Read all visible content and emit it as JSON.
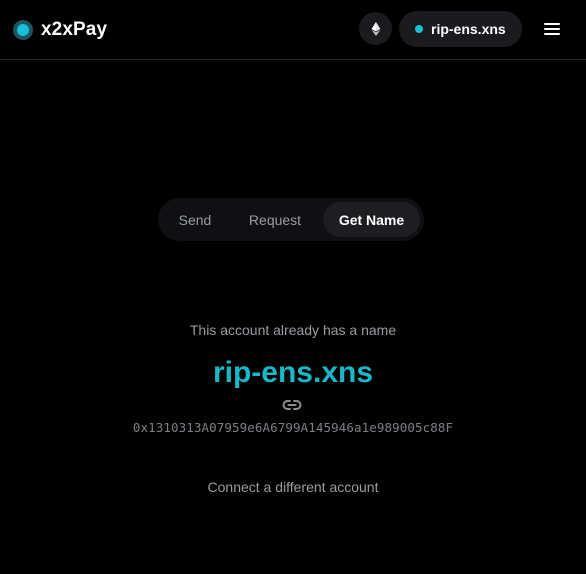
{
  "header": {
    "brand_name": "x2xPay",
    "network_icon": "ethereum-icon",
    "account_name": "rip-ens.xns",
    "menu_icon": "hamburger-menu-icon"
  },
  "tabs": [
    {
      "label": "Send",
      "active": false
    },
    {
      "label": "Request",
      "active": false
    },
    {
      "label": "Get Name",
      "active": true
    }
  ],
  "main": {
    "notice": "This account already has a name",
    "name": "rip-ens.xns",
    "link_icon": "link-icon",
    "address": "0x1310313A07959e6A6799A145946a1e989005c88F",
    "connect_label": "Connect a different account"
  },
  "colors": {
    "background": "#000000",
    "accent": "#17b8c7",
    "surface": "#1a1b1f",
    "muted_text": "#9a9ca3"
  }
}
